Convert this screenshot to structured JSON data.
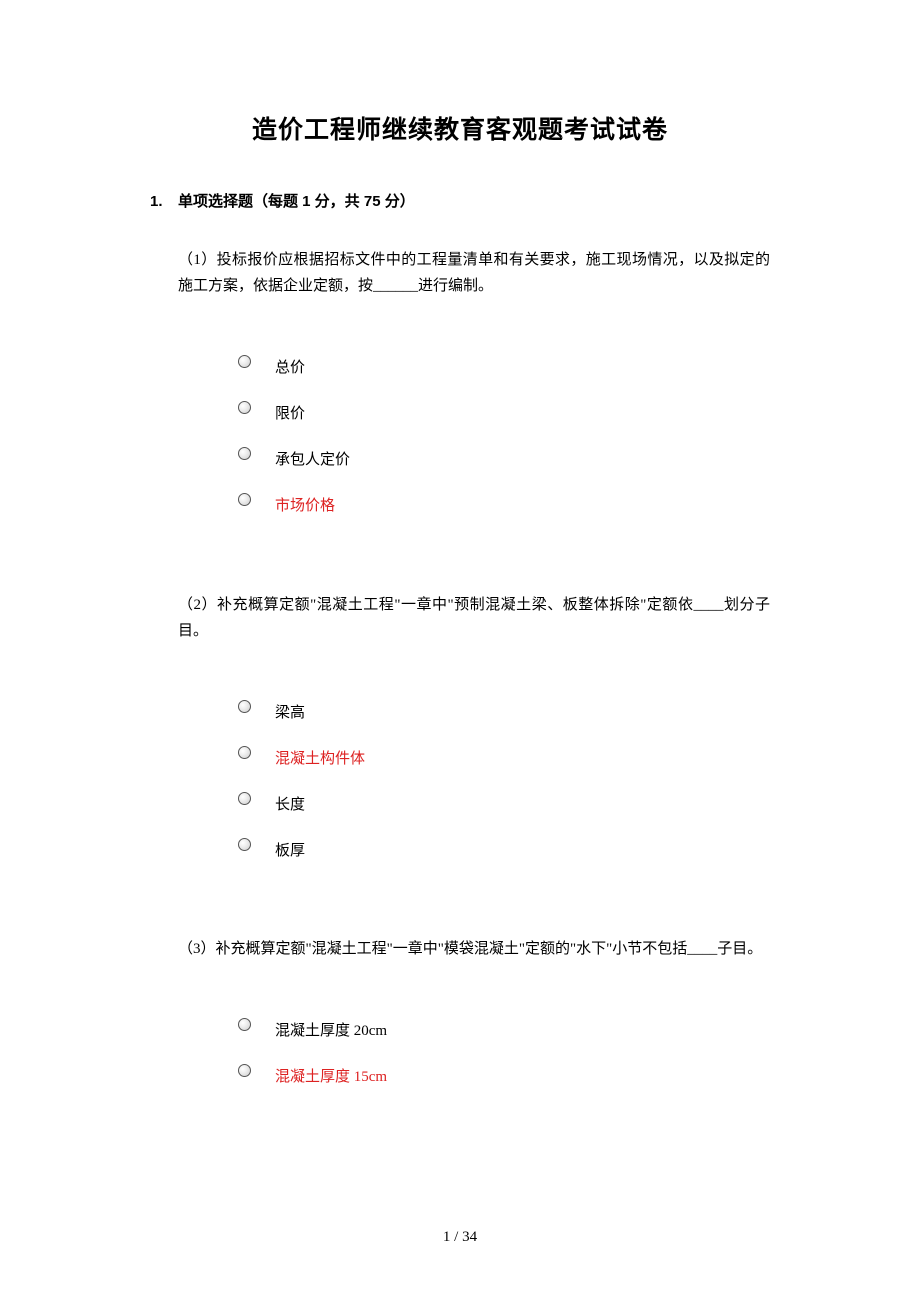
{
  "title": "造价工程师继续教育客观题考试试卷",
  "section": {
    "number": "1.",
    "heading": "单项选择题（每题 1 分，共 75 分）"
  },
  "questions": [
    {
      "text": "（1）投标报价应根据招标文件中的工程量清单和有关要求，施工现场情况，以及拟定的施工方案，依据企业定额，按______进行编制。",
      "options": [
        {
          "label": "总价",
          "correct": false
        },
        {
          "label": "限价",
          "correct": false
        },
        {
          "label": "承包人定价",
          "correct": false
        },
        {
          "label": "市场价格",
          "correct": true
        }
      ]
    },
    {
      "text": "（2）补充概算定额\"混凝土工程\"一章中\"预制混凝土梁、板整体拆除\"定额依____划分子目。",
      "options": [
        {
          "label": "梁高",
          "correct": false
        },
        {
          "label": "混凝土构件体",
          "correct": true
        },
        {
          "label": "长度",
          "correct": false
        },
        {
          "label": "板厚",
          "correct": false
        }
      ]
    },
    {
      "text": "（3）补充概算定额\"混凝土工程\"一章中\"模袋混凝土\"定额的\"水下\"小节不包括____子目。",
      "options": [
        {
          "label": "混凝土厚度 20cm",
          "correct": false
        },
        {
          "label": "混凝土厚度 15cm",
          "correct": true
        }
      ]
    }
  ],
  "footer": {
    "current_page": "1",
    "separator": " / ",
    "total_pages": "34"
  }
}
